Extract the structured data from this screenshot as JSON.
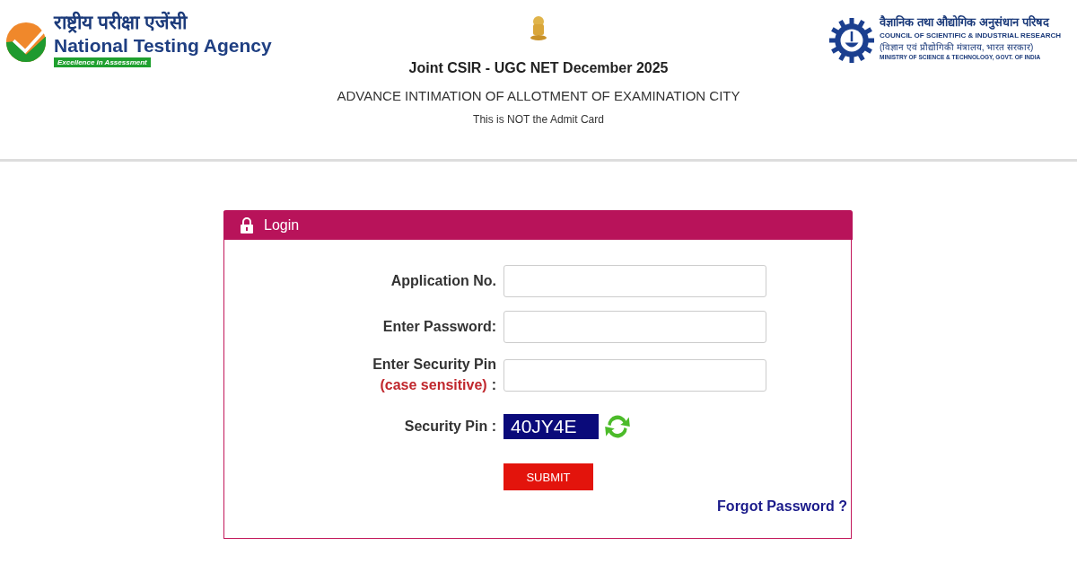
{
  "header": {
    "nta": {
      "hindi": "राष्ट्रीय परीक्षा एजेंसी",
      "name": "National Testing Agency",
      "tagline": "Excellence in Assessment"
    },
    "title": "Joint CSIR - UGC NET December 2025",
    "subtitle": "ADVANCE INTIMATION OF ALLOTMENT OF EXAMINATION CITY",
    "note": "This is NOT the Admit Card",
    "csir": {
      "hindi": "वैज्ञानिक तथा औद्योगिक अनुसंधान परिषद",
      "name": "COUNCIL OF SCIENTIFIC & INDUSTRIAL RESEARCH",
      "hindi_ministry": "(विज्ञान एवं प्रौद्योगिकी मंत्रालय, भारत सरकार)",
      "ministry": "MINISTRY OF SCIENCE & TECHNOLOGY, GOVT. OF INDIA"
    }
  },
  "login": {
    "title": "Login",
    "fields": [
      {
        "label": "Application No."
      },
      {
        "label": "Enter Password:"
      },
      {
        "label": "Enter Security Pin",
        "hint": "(case sensitive)",
        "suffix": ":"
      }
    ],
    "captcha": {
      "label": "Security Pin :",
      "code": "40JY4E"
    },
    "submit": "SUBMIT",
    "forgot": "Forgot Password ?"
  }
}
